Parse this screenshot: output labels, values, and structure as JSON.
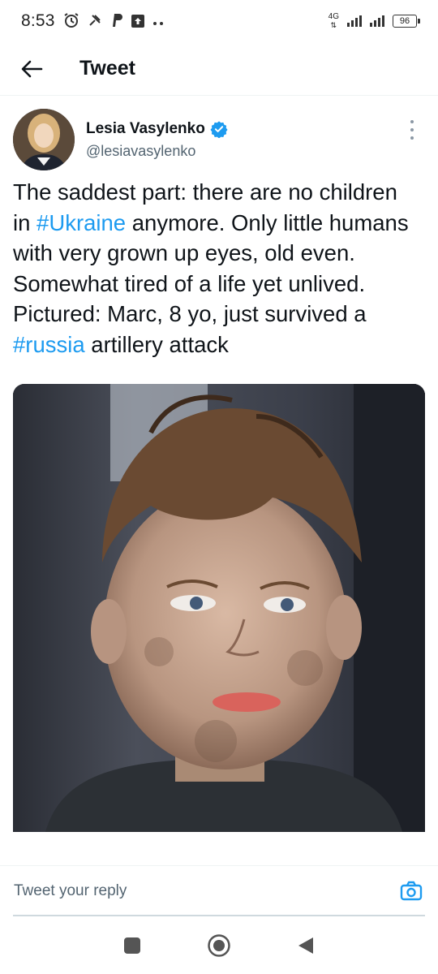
{
  "status_bar": {
    "time": "8:53",
    "network": "4G",
    "battery": "96",
    "icons": [
      "alarm-icon",
      "tools-icon",
      "paypal-icon",
      "upload-box-icon",
      "more-dots-icon",
      "signal-icon",
      "wifi-signal-icon",
      "battery-icon"
    ]
  },
  "header": {
    "title": "Tweet",
    "back_icon": "arrow-left-icon"
  },
  "tweet": {
    "author": {
      "name": "Lesia Vasylenko",
      "handle": "@lesiavasylenko",
      "verified": true
    },
    "text": {
      "part1": "The saddest part: there are no children in ",
      "hashtag1": "#Ukraine",
      "part2": " anymore. Only little humans with very grown up eyes, old even. Somewhat tired of a life yet unlived. Pictured: Marc, 8 yo, just survived a ",
      "hashtag2": "#russia",
      "part3": " artillery attack"
    }
  },
  "reply": {
    "placeholder": "Tweet your reply",
    "camera_icon": "camera-icon"
  },
  "nav": {
    "icons": [
      "square-recents-icon",
      "circle-home-icon",
      "triangle-back-icon"
    ]
  },
  "colors": {
    "accent": "#1d9bf0",
    "text": "#0f1419",
    "secondary": "#536471"
  }
}
